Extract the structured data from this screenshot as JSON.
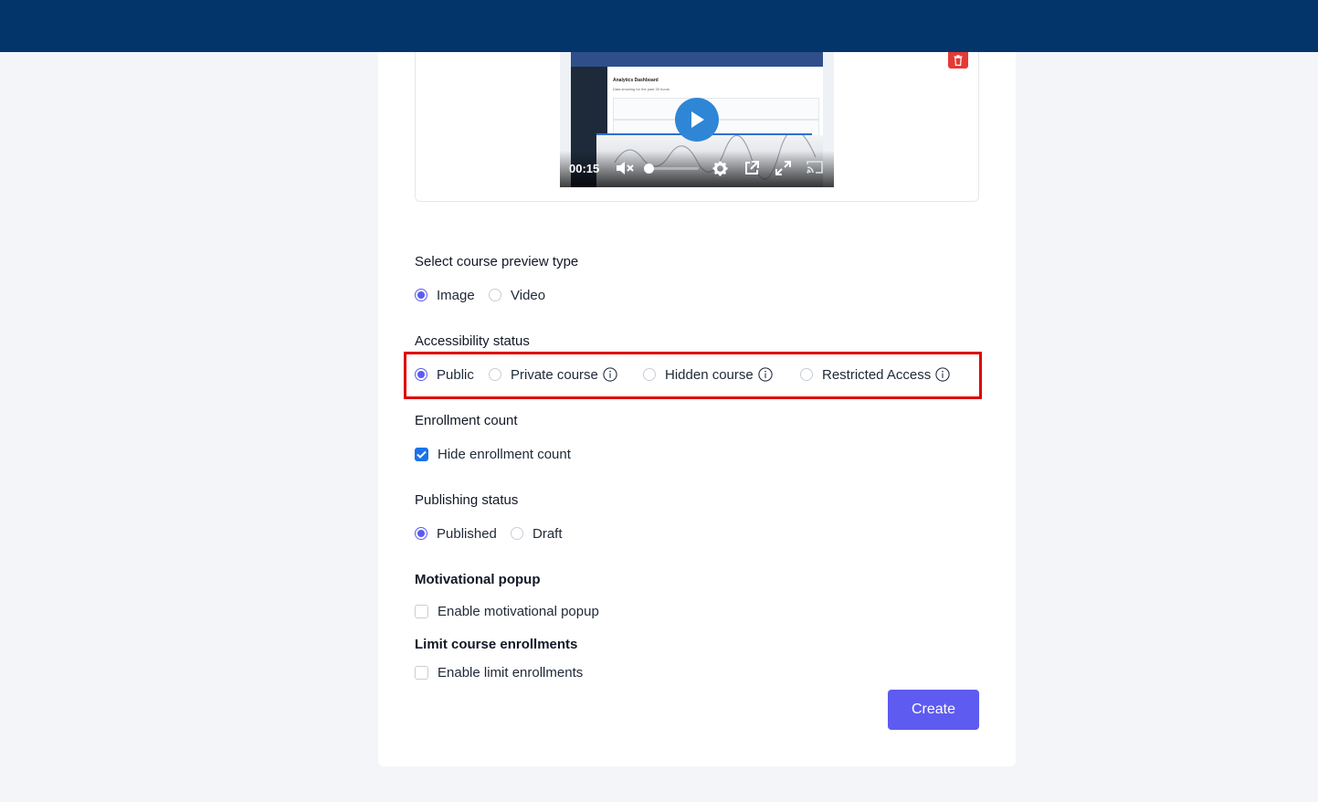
{
  "video": {
    "time": "00:15",
    "screen_title": "Analytics Dashboard",
    "screen_subtitle": "Data showing for the past 30 hours"
  },
  "preview_type": {
    "label": "Select course preview type",
    "options": [
      {
        "label": "Image",
        "checked": true
      },
      {
        "label": "Video",
        "checked": false
      }
    ]
  },
  "accessibility": {
    "label": "Accessibility status",
    "options": [
      {
        "label": "Public",
        "checked": true
      },
      {
        "label": "Private course",
        "checked": false
      },
      {
        "label": "Hidden course",
        "checked": false
      },
      {
        "label": "Restricted Access",
        "checked": false
      }
    ]
  },
  "enrollment_count": {
    "label": "Enrollment count",
    "checkbox_label": "Hide enrollment count",
    "checked": true
  },
  "publishing": {
    "label": "Publishing status",
    "options": [
      {
        "label": "Published",
        "checked": true
      },
      {
        "label": "Draft",
        "checked": false
      }
    ]
  },
  "motivational_popup": {
    "label": "Motivational popup",
    "checkbox_label": "Enable motivational popup",
    "checked": false
  },
  "limit_enrollments": {
    "label": "Limit course enrollments",
    "checkbox_label": "Enable limit enrollments",
    "checked": false
  },
  "actions": {
    "create_label": "Create"
  },
  "colors": {
    "topbar": "#03346a",
    "accent": "#5e5bf0",
    "checkbox_checked": "#1a73e8",
    "delete": "#e53935",
    "highlight": "#e00000"
  },
  "icons": [
    "trash-icon",
    "play-icon",
    "mute-icon",
    "settings-icon",
    "popout-icon",
    "fullscreen-icon",
    "cast-icon",
    "info-icon",
    "check-icon"
  ]
}
